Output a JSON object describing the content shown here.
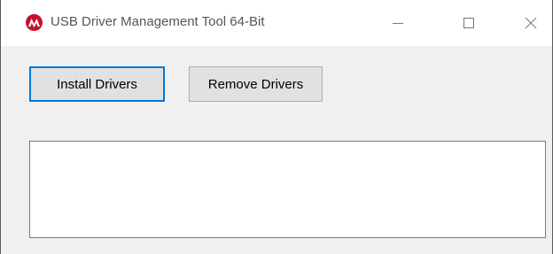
{
  "window": {
    "title": "USB Driver Management Tool 64-Bit",
    "app_icon": "microchip-logo-icon",
    "controls": {
      "minimize_icon": "minimize-icon",
      "maximize_icon": "maximize-icon",
      "close_icon": "close-icon"
    }
  },
  "buttons": {
    "install_label": "Install Drivers",
    "remove_label": "Remove Drivers"
  },
  "output": {
    "text": ""
  },
  "colors": {
    "logo_red": "#c8102e",
    "focus_blue": "#0078d7",
    "button_face": "#e1e1e1",
    "window_bg": "#f0f0f0"
  }
}
